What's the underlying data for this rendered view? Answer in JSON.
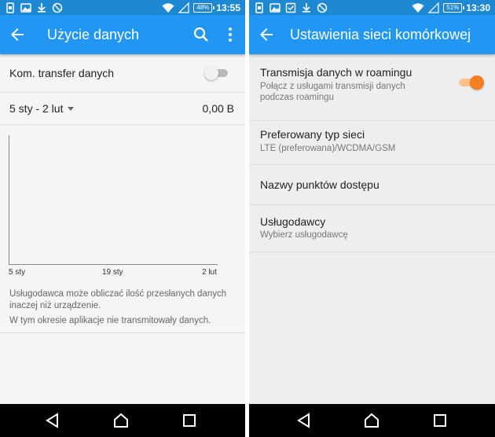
{
  "colors": {
    "status_bar": "#1e88d2",
    "toolbar": "#2196f3",
    "switch_on": "#f57f20",
    "switch_off_track": "#b9b9b9",
    "navbar": "#000000"
  },
  "left": {
    "status": {
      "battery": "48%",
      "time": "13:55"
    },
    "toolbar": {
      "back_icon": "arrow-back-icon",
      "title": "Użycie danych",
      "search_icon": "search-icon",
      "more_icon": "more-vert-icon"
    },
    "mobile_data_toggle": {
      "label": "Kom. transfer danych",
      "on": false
    },
    "date_range": {
      "label": "5 sty - 2 lut",
      "value": "0,00 B"
    },
    "chart": {
      "x_ticks": [
        "5 sty",
        "19 sty",
        "2 lut"
      ]
    },
    "notes": [
      "Usługodawca może obliczać ilość przesłanych danych inaczej niż urządzenie.",
      "W tym okresie aplikacje nie transmitowały danych."
    ]
  },
  "right": {
    "status": {
      "battery": "51%",
      "time": "13:30"
    },
    "toolbar": {
      "back_icon": "arrow-back-icon",
      "title": "Ustawienia sieci komórkowej"
    },
    "items": [
      {
        "title": "Transmisja danych w roamingu",
        "subtitle": "Połącz z usługami transmisji danych podczas roamingu",
        "switch_on": true
      },
      {
        "title": "Preferowany typ sieci",
        "subtitle": "LTE (preferowana)/WCDMA/GSM"
      },
      {
        "title": "Nazwy punktów dostępu"
      },
      {
        "title": "Usługodawcy",
        "subtitle": "Wybierz usługodawcę"
      }
    ]
  },
  "nav": {
    "back_icon": "nav-back-icon",
    "home_icon": "nav-home-icon",
    "recents_icon": "nav-recents-icon"
  }
}
